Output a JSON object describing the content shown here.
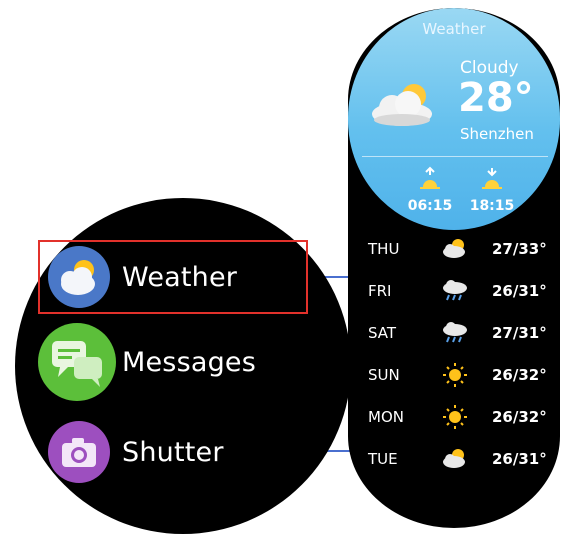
{
  "apps": [
    {
      "label": "Weather",
      "icon": "weather-cloud-sun-icon"
    },
    {
      "label": "Messages",
      "icon": "chat-bubbles-icon"
    },
    {
      "label": "Shutter",
      "icon": "camera-icon"
    }
  ],
  "weather": {
    "title": "Weather",
    "condition": "Cloudy",
    "temperature": "28°",
    "city": "Shenzhen",
    "sunrise": "06:15",
    "sunset": "18:15"
  },
  "forecast": [
    {
      "day": "THU",
      "temp": "27/33°",
      "icon": "cloud-sun-icon"
    },
    {
      "day": "FRI",
      "temp": "26/31°",
      "icon": "rain-cloud-icon"
    },
    {
      "day": "SAT",
      "temp": "27/31°",
      "icon": "rain-cloud-icon"
    },
    {
      "day": "SUN",
      "temp": "26/32°",
      "icon": "sun-icon"
    },
    {
      "day": "MON",
      "temp": "26/32°",
      "icon": "sun-icon"
    },
    {
      "day": "TUE",
      "temp": "26/31°",
      "icon": "cloud-sun-icon"
    }
  ],
  "colors": {
    "highlight": "#e2312b",
    "connector": "#4a6fcf",
    "weather_icon_bg": "#4a78c8",
    "messages_icon_bg": "#5cbf3a",
    "shutter_icon_bg": "#9d4fbf",
    "weather_panel_gradient": [
      "#9ad8f3",
      "#4fb2ea"
    ]
  }
}
